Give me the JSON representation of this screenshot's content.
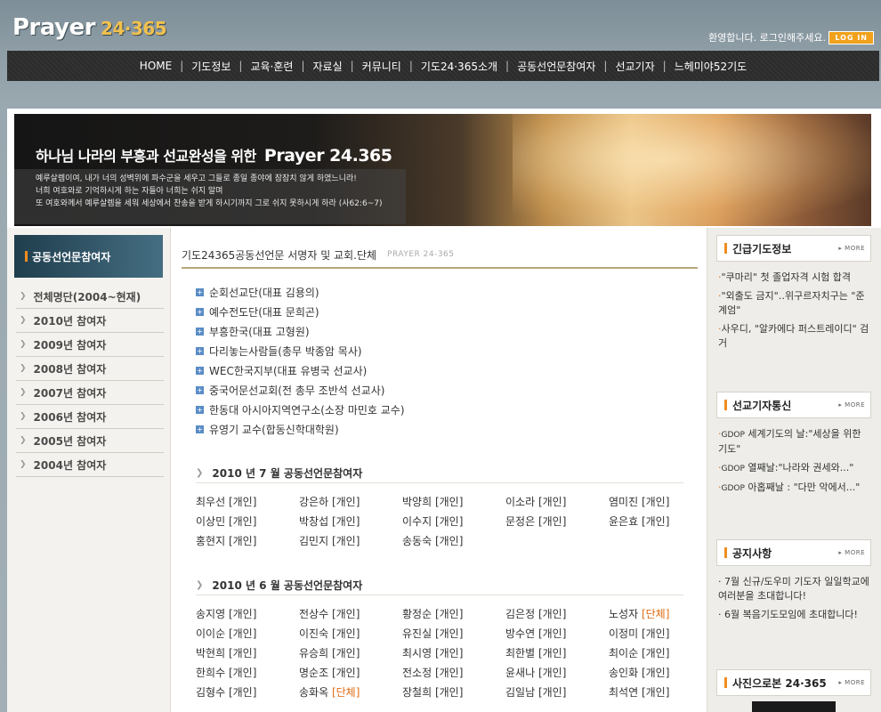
{
  "header": {
    "logo_text": "Prayer",
    "logo_num": "24·365",
    "welcome": "환영합니다. 로그인해주세요.",
    "login_label": "LOG IN"
  },
  "nav": [
    "HOME",
    "기도정보",
    "교육·훈련",
    "자료실",
    "커뮤니티",
    "기도24·365소개",
    "공동선언문참여자",
    "선교기자",
    "느헤미야52기도"
  ],
  "banner": {
    "headline": "하나님 나라의 부흥과 선교완성을 위한",
    "brand": "Prayer 24.365",
    "verse_lines": [
      "예루살렘이여, 내가 너의 성벽위에 파수군을 세우고 그들로 종일 종야에 잠잠치 않게 하였느니라!",
      "너희 여호와로 기억하시게 하는 자들아 너희는 쉬지 말며",
      "또 여호와께서 예루살렘을 세워 세상에서 찬송을 받게 하시기까지 그로 쉬지 못하시게 하라 (사62:6~7)"
    ]
  },
  "left_sidebar": {
    "title": "공동선언문참여자",
    "items": [
      "전체명단(2004~현재)",
      "2010년 참여자",
      "2009년 참여자",
      "2008년 참여자",
      "2007년 참여자",
      "2006년 참여자",
      "2005년 참여자",
      "2004년 참여자"
    ]
  },
  "main": {
    "title": "기도24365공동선언문 서명자 및 교회.단체",
    "subtitle": "PRAYER 24-365",
    "orgs": [
      "순회선교단(대표 김용의)",
      "예수전도단(대표 문희곤)",
      "부흥한국(대표 고형원)",
      "다리놓는사람들(총무 박종암 목사)",
      "WEC한국지부(대표 유병국 선교사)",
      "중국어문선교회(전 총무 조반석 선교사)",
      "한동대 아시아지역연구소(소장 마민호 교수)",
      "유영기 교수(합동신학대학원)"
    ],
    "sections": [
      {
        "title": "2010 년 7 월 공동선언문참여자",
        "people": [
          {
            "name": "최우선",
            "tag": "[개인]"
          },
          {
            "name": "강은하",
            "tag": "[개인]"
          },
          {
            "name": "박양희",
            "tag": "[개인]"
          },
          {
            "name": "이소라",
            "tag": "[개인]"
          },
          {
            "name": "염미진",
            "tag": "[개인]"
          },
          {
            "name": "이상민",
            "tag": "[개인]"
          },
          {
            "name": "박창섭",
            "tag": "[개인]"
          },
          {
            "name": "이수지",
            "tag": "[개인]"
          },
          {
            "name": "문정은",
            "tag": "[개인]"
          },
          {
            "name": "윤은효",
            "tag": "[개인]"
          },
          {
            "name": "홍현지",
            "tag": "[개인]"
          },
          {
            "name": "김민지",
            "tag": "[개인]"
          },
          {
            "name": "송동숙",
            "tag": "[개인]"
          }
        ]
      },
      {
        "title": "2010 년 6 월 공동선언문참여자",
        "people": [
          {
            "name": "송지영",
            "tag": "[개인]"
          },
          {
            "name": "전상수",
            "tag": "[개인]"
          },
          {
            "name": "황정순",
            "tag": "[개인]"
          },
          {
            "name": "김은정",
            "tag": "[개인]"
          },
          {
            "name": "노성자",
            "tag": "[단체]"
          },
          {
            "name": "이이순",
            "tag": "[개인]"
          },
          {
            "name": "이진숙",
            "tag": "[개인]"
          },
          {
            "name": "유진실",
            "tag": "[개인]"
          },
          {
            "name": "방수연",
            "tag": "[개인]"
          },
          {
            "name": "이정미",
            "tag": "[개인]"
          },
          {
            "name": "박현희",
            "tag": "[개인]"
          },
          {
            "name": "유승희",
            "tag": "[개인]"
          },
          {
            "name": "최시영",
            "tag": "[개인]"
          },
          {
            "name": "최한별",
            "tag": "[개인]"
          },
          {
            "name": "최이순",
            "tag": "[개인]"
          },
          {
            "name": "한희수",
            "tag": "[개인]"
          },
          {
            "name": "명순조",
            "tag": "[개인]"
          },
          {
            "name": "전소정",
            "tag": "[개인]"
          },
          {
            "name": "윤새나",
            "tag": "[개인]"
          },
          {
            "name": "송인화",
            "tag": "[개인]"
          },
          {
            "name": "김형수",
            "tag": "[개인]"
          },
          {
            "name": "송화옥",
            "tag": "[단체]"
          },
          {
            "name": "장철희",
            "tag": "[개인]"
          },
          {
            "name": "김일남",
            "tag": "[개인]"
          },
          {
            "name": "최석연",
            "tag": "[개인]"
          }
        ]
      }
    ]
  },
  "right_sidebar": {
    "more_label": "MORE",
    "urgent": {
      "title": "긴급기도정보",
      "items": [
        "\"쿠마리\" 첫 졸업자격 시험 합격",
        "\"외출도 금지\"‥위구르자치구는 \"준계엄\"",
        "사우디, \"알카에다 퍼스트레이디\" 검거"
      ]
    },
    "reporter": {
      "title": "선교기자통신",
      "items": [
        {
          "gd": "GDOP",
          "text": "세계기도의 날:\"세상을 위한 기도\""
        },
        {
          "gd": "GDOP",
          "text": "열째날:\"나라와 권세와...\""
        },
        {
          "gd": "GDOP",
          "text": "아홉째날 : \"다만 악에서...\""
        }
      ]
    },
    "notice": {
      "title": "공지사항",
      "items": [
        "7월 신규/도우미 기도자 일일학교에 여러분을 초대합니다!",
        "6월 복음기도모임에 초대합니다!"
      ]
    },
    "photo": {
      "title": "사진으로본 24·365"
    }
  },
  "colors": {
    "accent_orange": "#f08c1e",
    "group_tag": "#e06b12",
    "nav_bg": "#2b2b2b",
    "sidebar_title_bg": "#1f3e4d"
  }
}
